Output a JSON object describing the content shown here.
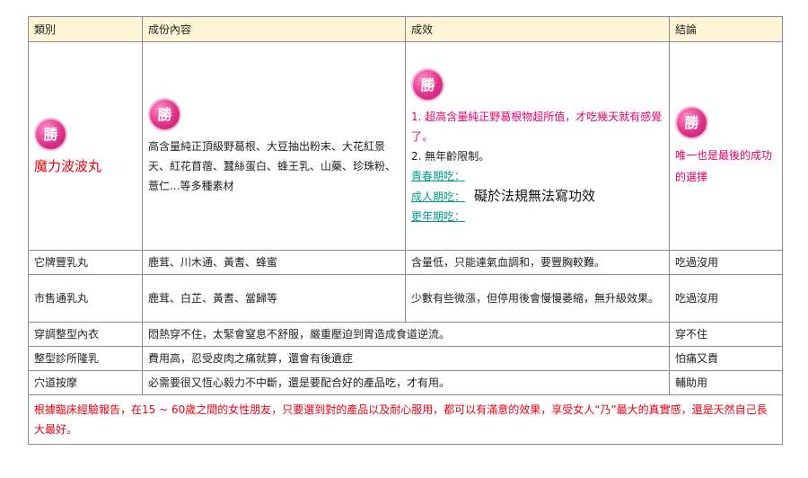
{
  "headers": {
    "category": "類別",
    "ingredients": "成份內容",
    "effect": "成效",
    "conclusion": "結論"
  },
  "badge_text": "勝",
  "featured": {
    "name": "魔力波波丸",
    "ingredients": "高含量純正頂級野葛根、大豆抽出粉末、大花紅景天、紅花苜蓿、蠶絲蛋白、蜂王乳、山藥、珍珠粉、薏仁...等多種素材",
    "effect_1": "1. 超高含量純正野葛根物超所值，才吃幾天就有感覺了。",
    "effect_2": "2. 無年齡限制。",
    "stage_1": "青春期吃：",
    "stage_2": "成人期吃：",
    "stage_3": "更年期吃：",
    "law_note": "礙於法規無法寫功效",
    "conclusion": "唯一也是最後的成功的選擇"
  },
  "rows": [
    {
      "category": "它牌豐乳丸",
      "ingredients": "鹿茸、川木通、黃耆、蜂蜜",
      "effect": "含量低，只能達氣血調和，要豐胸較難。",
      "conclusion": "吃過沒用"
    },
    {
      "category": "市售通乳丸",
      "ingredients": "鹿茸、白芷、黃耆、當歸等",
      "effect": "少數有些微漲，但停用後會慢慢萎縮，無升級效果。",
      "conclusion": "吃過沒用"
    },
    {
      "category": "穿調整型內衣",
      "ingredients": "悶熱穿不住，太緊會窒息不舒服，嚴重壓迫到胃造成食道逆流。",
      "conclusion": "穿不住"
    },
    {
      "category": "整型診所隆乳",
      "ingredients": "費用高，忍受皮肉之痛就算，還會有後遺症",
      "conclusion": "怕痛又貴"
    },
    {
      "category": "穴道按摩",
      "ingredients": "必需要很又恆心毅力不中斷，還是要配合好的產品吃，才有用。",
      "conclusion": "輔助用"
    }
  ],
  "footer": "根據臨床經驗報告，在15 ~ 60歲之間的女性朋友，只要選到對的產品以及耐心服用，都可以有滿意的效果，享受女人“乃”最大的真實感，還是天然自己長大最好。"
}
